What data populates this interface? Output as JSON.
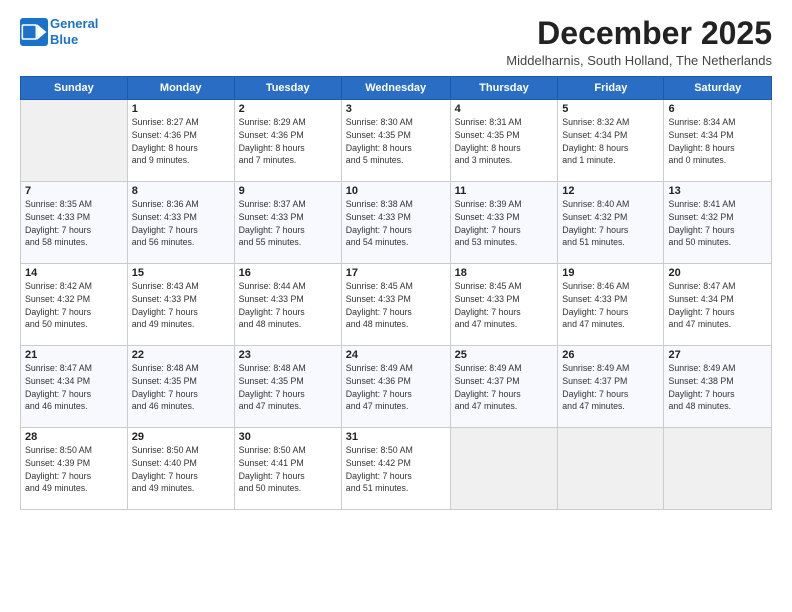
{
  "header": {
    "logo_line1": "General",
    "logo_line2": "Blue",
    "month_title": "December 2025",
    "subtitle": "Middelharnis, South Holland, The Netherlands"
  },
  "days_of_week": [
    "Sunday",
    "Monday",
    "Tuesday",
    "Wednesday",
    "Thursday",
    "Friday",
    "Saturday"
  ],
  "weeks": [
    [
      {
        "day": "",
        "info": ""
      },
      {
        "day": "1",
        "info": "Sunrise: 8:27 AM\nSunset: 4:36 PM\nDaylight: 8 hours\nand 9 minutes."
      },
      {
        "day": "2",
        "info": "Sunrise: 8:29 AM\nSunset: 4:36 PM\nDaylight: 8 hours\nand 7 minutes."
      },
      {
        "day": "3",
        "info": "Sunrise: 8:30 AM\nSunset: 4:35 PM\nDaylight: 8 hours\nand 5 minutes."
      },
      {
        "day": "4",
        "info": "Sunrise: 8:31 AM\nSunset: 4:35 PM\nDaylight: 8 hours\nand 3 minutes."
      },
      {
        "day": "5",
        "info": "Sunrise: 8:32 AM\nSunset: 4:34 PM\nDaylight: 8 hours\nand 1 minute."
      },
      {
        "day": "6",
        "info": "Sunrise: 8:34 AM\nSunset: 4:34 PM\nDaylight: 8 hours\nand 0 minutes."
      }
    ],
    [
      {
        "day": "7",
        "info": "Sunrise: 8:35 AM\nSunset: 4:33 PM\nDaylight: 7 hours\nand 58 minutes."
      },
      {
        "day": "8",
        "info": "Sunrise: 8:36 AM\nSunset: 4:33 PM\nDaylight: 7 hours\nand 56 minutes."
      },
      {
        "day": "9",
        "info": "Sunrise: 8:37 AM\nSunset: 4:33 PM\nDaylight: 7 hours\nand 55 minutes."
      },
      {
        "day": "10",
        "info": "Sunrise: 8:38 AM\nSunset: 4:33 PM\nDaylight: 7 hours\nand 54 minutes."
      },
      {
        "day": "11",
        "info": "Sunrise: 8:39 AM\nSunset: 4:33 PM\nDaylight: 7 hours\nand 53 minutes."
      },
      {
        "day": "12",
        "info": "Sunrise: 8:40 AM\nSunset: 4:32 PM\nDaylight: 7 hours\nand 51 minutes."
      },
      {
        "day": "13",
        "info": "Sunrise: 8:41 AM\nSunset: 4:32 PM\nDaylight: 7 hours\nand 50 minutes."
      }
    ],
    [
      {
        "day": "14",
        "info": "Sunrise: 8:42 AM\nSunset: 4:32 PM\nDaylight: 7 hours\nand 50 minutes."
      },
      {
        "day": "15",
        "info": "Sunrise: 8:43 AM\nSunset: 4:33 PM\nDaylight: 7 hours\nand 49 minutes."
      },
      {
        "day": "16",
        "info": "Sunrise: 8:44 AM\nSunset: 4:33 PM\nDaylight: 7 hours\nand 48 minutes."
      },
      {
        "day": "17",
        "info": "Sunrise: 8:45 AM\nSunset: 4:33 PM\nDaylight: 7 hours\nand 48 minutes."
      },
      {
        "day": "18",
        "info": "Sunrise: 8:45 AM\nSunset: 4:33 PM\nDaylight: 7 hours\nand 47 minutes."
      },
      {
        "day": "19",
        "info": "Sunrise: 8:46 AM\nSunset: 4:33 PM\nDaylight: 7 hours\nand 47 minutes."
      },
      {
        "day": "20",
        "info": "Sunrise: 8:47 AM\nSunset: 4:34 PM\nDaylight: 7 hours\nand 47 minutes."
      }
    ],
    [
      {
        "day": "21",
        "info": "Sunrise: 8:47 AM\nSunset: 4:34 PM\nDaylight: 7 hours\nand 46 minutes."
      },
      {
        "day": "22",
        "info": "Sunrise: 8:48 AM\nSunset: 4:35 PM\nDaylight: 7 hours\nand 46 minutes."
      },
      {
        "day": "23",
        "info": "Sunrise: 8:48 AM\nSunset: 4:35 PM\nDaylight: 7 hours\nand 47 minutes."
      },
      {
        "day": "24",
        "info": "Sunrise: 8:49 AM\nSunset: 4:36 PM\nDaylight: 7 hours\nand 47 minutes."
      },
      {
        "day": "25",
        "info": "Sunrise: 8:49 AM\nSunset: 4:37 PM\nDaylight: 7 hours\nand 47 minutes."
      },
      {
        "day": "26",
        "info": "Sunrise: 8:49 AM\nSunset: 4:37 PM\nDaylight: 7 hours\nand 47 minutes."
      },
      {
        "day": "27",
        "info": "Sunrise: 8:49 AM\nSunset: 4:38 PM\nDaylight: 7 hours\nand 48 minutes."
      }
    ],
    [
      {
        "day": "28",
        "info": "Sunrise: 8:50 AM\nSunset: 4:39 PM\nDaylight: 7 hours\nand 49 minutes."
      },
      {
        "day": "29",
        "info": "Sunrise: 8:50 AM\nSunset: 4:40 PM\nDaylight: 7 hours\nand 49 minutes."
      },
      {
        "day": "30",
        "info": "Sunrise: 8:50 AM\nSunset: 4:41 PM\nDaylight: 7 hours\nand 50 minutes."
      },
      {
        "day": "31",
        "info": "Sunrise: 8:50 AM\nSunset: 4:42 PM\nDaylight: 7 hours\nand 51 minutes."
      },
      {
        "day": "",
        "info": ""
      },
      {
        "day": "",
        "info": ""
      },
      {
        "day": "",
        "info": ""
      }
    ]
  ]
}
